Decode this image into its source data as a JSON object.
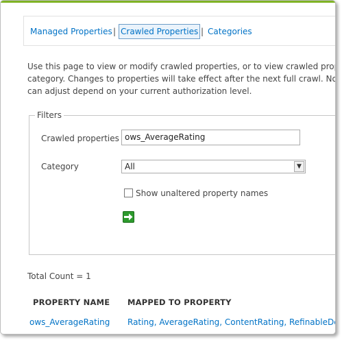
{
  "nav": {
    "managed": "Managed Properties",
    "crawled": "Crawled Properties",
    "categories": "Categories",
    "separator": "|"
  },
  "description": {
    "line1": "Use this page to view or modify crawled properties, or to view crawled prop",
    "line2": "category. Changes to properties will take effect after the next full crawl. Note",
    "line3": "can adjust depend on your current authorization level."
  },
  "filters": {
    "legend": "Filters",
    "crawled_label": "Crawled properties",
    "crawled_value": "ows_AverageRating",
    "category_label": "Category",
    "category_value": "All",
    "show_unaltered_label": "Show unaltered property names",
    "show_unaltered_checked": false,
    "go_icon": "green-arrow-right-icon"
  },
  "results": {
    "total_count": "Total Count = 1",
    "columns": [
      "PROPERTY NAME",
      "MAPPED TO PROPERTY"
    ],
    "rows": [
      {
        "property_name": "ows_AverageRating",
        "mapped_to": "Rating, AverageRating, ContentRating, RefinableDec"
      }
    ]
  },
  "colors": {
    "accent_bar": "#7fb324",
    "link": "#0072c6",
    "go_button": "#2d9a2d"
  }
}
